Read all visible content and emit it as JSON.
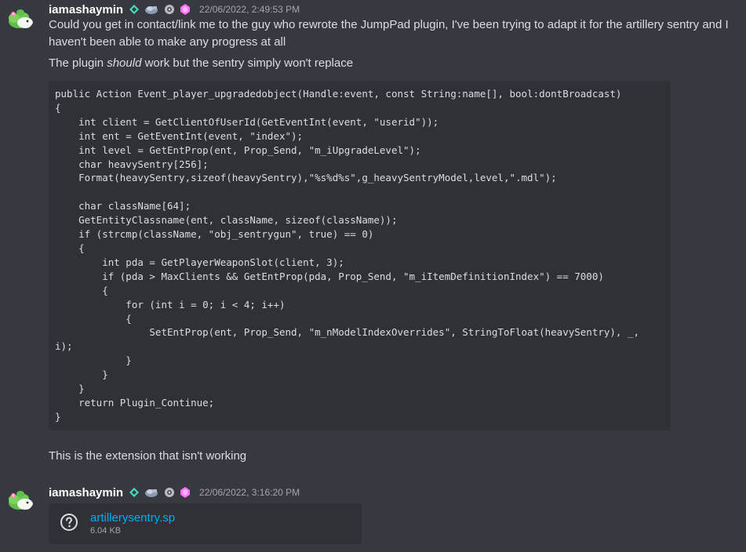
{
  "messages": [
    {
      "username": "iamashaymin",
      "timestamp": "22/06/2022, 2:49:53 PM",
      "badges": [
        "diamond-badge-icon",
        "brand-badge-icon",
        "boost-badge-icon",
        "nitro-gem-icon"
      ],
      "paragraph1": "Could you get in contact/link me to the guy who rewrote the JumpPad plugin, I've been trying to adapt it for the artillery sentry and I haven't been able to make any progress at all",
      "paragraph2_before": "The plugin ",
      "paragraph2_em": "should",
      "paragraph2_after": " work but the sentry simply won't replace",
      "code_lines": [
        "public Action Event_player_upgradedobject(Handle:event, const String:name[], bool:dontBroadcast)",
        "{",
        "    int client = GetClientOfUserId(GetEventInt(event, \"userid\"));",
        "    int ent = GetEventInt(event, \"index\");",
        "    int level = GetEntProp(ent, Prop_Send, \"m_iUpgradeLevel\");",
        "    char heavySentry[256];",
        "    Format(heavySentry,sizeof(heavySentry),\"%s%d%s\",g_heavySentryModel,level,\".mdl\");",
        "",
        "    char className[64];",
        "    GetEntityClassname(ent, className, sizeof(className));",
        "    if (strcmp(className, \"obj_sentrygun\", true) == 0)",
        "    {",
        "        int pda = GetPlayerWeaponSlot(client, 3);",
        "        if (pda > MaxClients && GetEntProp(pda, Prop_Send, \"m_iItemDefinitionIndex\") == 7000)",
        "        {",
        "            for (int i = 0; i < 4; i++)",
        "            {",
        "                SetEntProp(ent, Prop_Send, \"m_nModelIndexOverrides\", StringToFloat(heavySentry), _,",
        "i);",
        "            }",
        "        }",
        "    }",
        "    return Plugin_Continue;",
        "}"
      ],
      "paragraph3": "This is the extension that isn't working"
    },
    {
      "username": "iamashaymin",
      "timestamp": "22/06/2022, 3:16:20 PM",
      "badges": [
        "diamond-badge-icon",
        "brand-badge-icon",
        "boost-badge-icon",
        "nitro-gem-icon"
      ],
      "attachment": {
        "icon": "unknown-file-icon",
        "filename": "artillerysentry.sp",
        "size": "6.04 KB"
      }
    }
  ],
  "colors": {
    "background": "#36393f",
    "code_background": "#2f3136",
    "username": "#ffffff",
    "text": "#dcddde",
    "timestamp": "#a3a6aa",
    "link": "#00aff4",
    "diamond_badge": "#45ddc0",
    "nitro_gem": "#ff73fa"
  }
}
